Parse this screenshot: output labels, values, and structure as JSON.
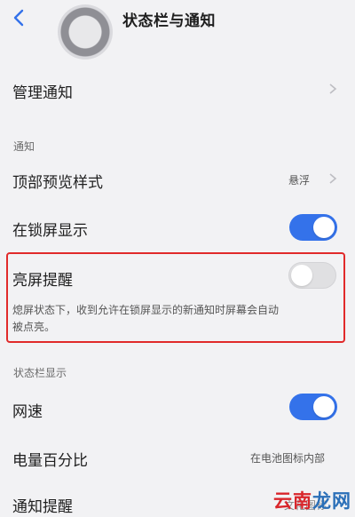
{
  "header": {
    "title": "状态栏与通知",
    "back_icon": "chevron-left-icon"
  },
  "rows": {
    "manage_notifications": "管理通知",
    "section_notifications": "通知",
    "top_preview_style": "顶部预览样式",
    "top_preview_value": "悬浮",
    "lockscreen_show": "在锁屏显示",
    "lockscreen_show_on": true,
    "screen_wake": "亮屏提醒",
    "screen_wake_on": false,
    "screen_wake_desc_line1": "熄屏状态下，收到允许在锁屏显示的新通知时屏幕会自动",
    "screen_wake_desc_line2": "被点亮。",
    "section_status_bar": "状态栏显示",
    "network_speed": "网速",
    "network_speed_on": true,
    "battery_percent": "电量百分比",
    "battery_percent_value": "在电池图标内部",
    "notification_alert": "通知提醒",
    "notification_alert_value": "文花图标"
  },
  "watermark": {
    "text_red": "云南",
    "text_blue": "龙网"
  },
  "colors": {
    "accent": "#3472ea",
    "highlight": "#e12a2a",
    "background": "#f2f2f4"
  }
}
